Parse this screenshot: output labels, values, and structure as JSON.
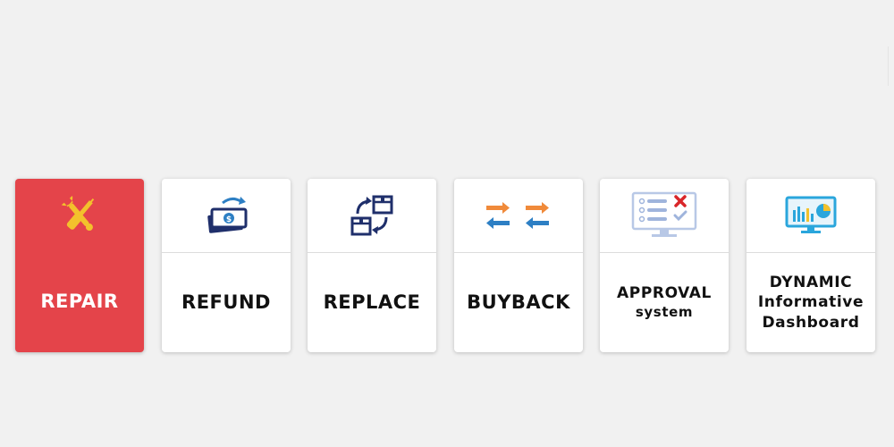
{
  "colors": {
    "background": "#f1f1f1",
    "active_card": "#e4444a",
    "card": "#ffffff",
    "text_dark": "#111111",
    "text_light": "#ffffff",
    "icon_yellow": "#f3c12c",
    "icon_navy": "#1f2f6b",
    "icon_orange": "#f08a3a",
    "icon_blue": "#2d7fc4",
    "icon_red": "#d9262a"
  },
  "cards": [
    {
      "id": "repair",
      "icon": "tools-icon",
      "line1": "REPAIR",
      "active": true
    },
    {
      "id": "refund",
      "icon": "money-refund-icon",
      "line1": "REFUND",
      "active": false
    },
    {
      "id": "replace",
      "icon": "box-exchange-icon",
      "line1": "REPLACE",
      "active": false
    },
    {
      "id": "buyback",
      "icon": "swap-arrows-icon",
      "line1": "BUYBACK",
      "active": false
    },
    {
      "id": "approval",
      "icon": "approval-checklist-icon",
      "line1": "APPROVAL",
      "line2": "system",
      "active": false
    },
    {
      "id": "dashboard",
      "icon": "dashboard-chart-icon",
      "line1": "DYNAMIC",
      "line2": "Informative",
      "line3": "Dashboard",
      "active": false
    }
  ]
}
